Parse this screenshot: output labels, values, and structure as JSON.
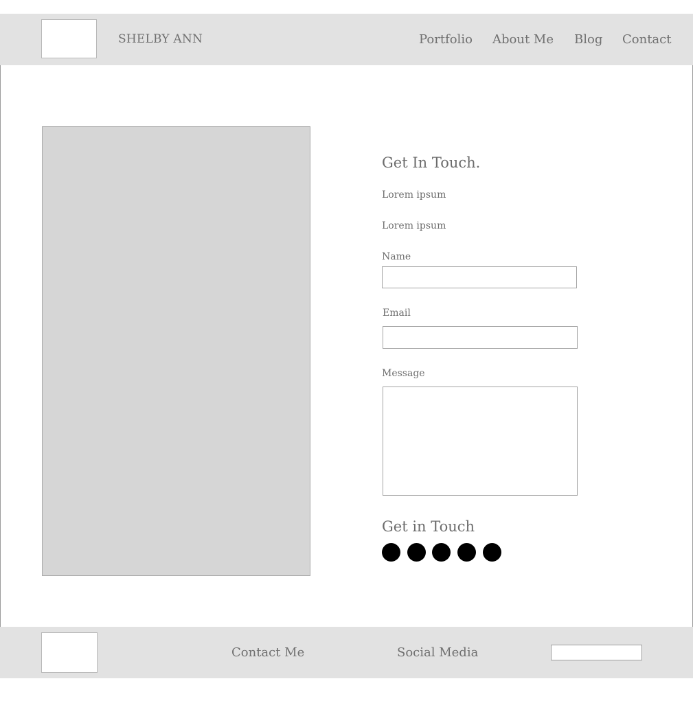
{
  "header": {
    "site_name": "SHELBY ANN",
    "nav": {
      "portfolio": "Portfolio",
      "about": "About Me",
      "blog": "Blog",
      "contact": "Contact"
    }
  },
  "main": {
    "heading": "Get In Touch.",
    "lines": [
      "Lorem ipsum",
      "Lorem ipsum"
    ],
    "form": {
      "name_label": "Name",
      "name_value": "",
      "email_label": "Email",
      "email_value": "",
      "message_label": "Message",
      "message_value": ""
    },
    "social_heading": "Get in Touch",
    "social_icons": [
      "social-icon",
      "social-icon",
      "social-icon",
      "social-icon",
      "social-icon"
    ]
  },
  "footer": {
    "contact_link": "Contact Me",
    "social_link": "Social Media",
    "input_value": ""
  },
  "colors": {
    "bar_background": "#e2e2e2",
    "image_placeholder": "#d6d6d6",
    "text": "#707070",
    "social_icon": "#000000"
  }
}
